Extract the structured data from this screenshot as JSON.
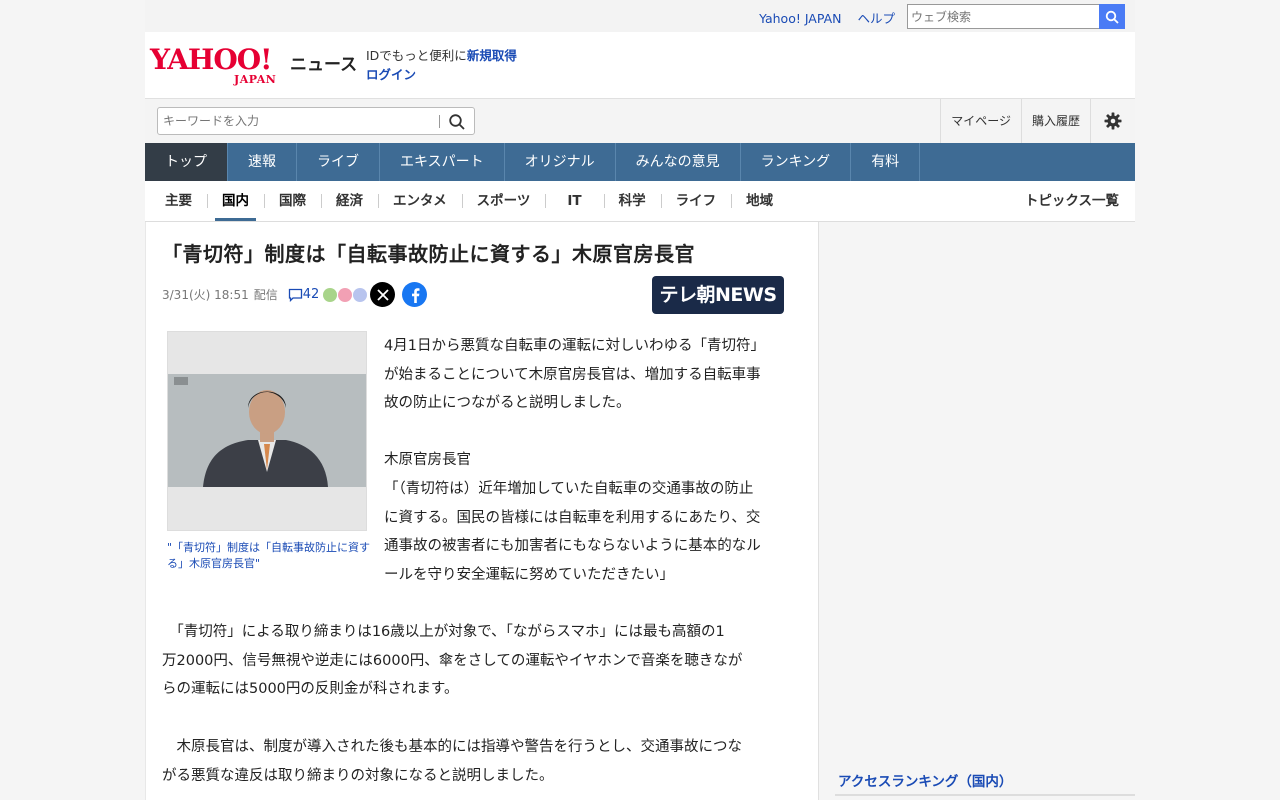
{
  "utility": {
    "yahoo_japan": "Yahoo! JAPAN",
    "help": "ヘルプ",
    "web_search_placeholder": "ウェブ検索"
  },
  "brand": {
    "logo_main": "YAHOO!",
    "logo_sub": "JAPAN",
    "service_name": "ニュース",
    "id_prompt": "IDでもっと便利に",
    "register": "新規取得",
    "login": "ログイン"
  },
  "search": {
    "placeholder": "キーワードを入力"
  },
  "header_links": {
    "mypage": "マイページ",
    "history": "購入履歴"
  },
  "main_nav": [
    "トップ",
    "速報",
    "ライブ",
    "エキスパート",
    "オリジナル",
    "みんなの意見",
    "ランキング",
    "有料"
  ],
  "sub_nav": [
    "主要",
    "国内",
    "国際",
    "経済",
    "エンタメ",
    "スポーツ",
    "IT",
    "科学",
    "ライフ",
    "地域"
  ],
  "topics_list": "トピックス一覧",
  "article": {
    "headline": "「青切符」制度は「自転事故防止に資する」木原官房長官",
    "date": "3/31(火) 18:51",
    "delivered": "配信",
    "comment_count": "42",
    "publisher": "テレ朝NEWS",
    "photo_caption": "\"「青切符」制度は「自転事故防止に資する」木原官房長官\"",
    "p1_lines": [
      "4月1日から悪質な自転車の運転に対しいわゆる「青切符」",
      "が始まることについて木原官房長官は、増加する自転車事",
      "故の防止につながると説明しました。"
    ],
    "speaker": "木原官房長官",
    "quote_lines": [
      "「（青切符は）近年増加していた自転車の交通事故の防止",
      "に資する。国民の皆様には自転車を利用するにあたり、交",
      "通事故の被害者にも加害者にもならないように基本的なル",
      "ールを守り安全運転に努めていただきたい」"
    ],
    "p2_lines": [
      "　「青切符」による取り締まりは16歳以上が対象で、「ながらスマホ」には最も高額の1",
      "万2000円、信号無視や逆走には6000円、傘をさしての運転やイヤホンで音楽を聴きなが",
      "らの運転には5000円の反則金が科されます。"
    ],
    "p3_lines": [
      "　木原長官は、制度が導入された後も基本的には指導や警告を行うとし、交通事故につな",
      "がる悪質な違反は取り締まりの対象になると説明しました。"
    ]
  },
  "sidebar": {
    "ranking_title": "アクセスランキング（国内）"
  },
  "colors": {
    "nav_blue": "#3e6b94",
    "nav_active": "#333d47",
    "link_blue": "#1a4bb5",
    "yahoo_red": "#e60033",
    "publisher_bg": "#1a2a48"
  }
}
